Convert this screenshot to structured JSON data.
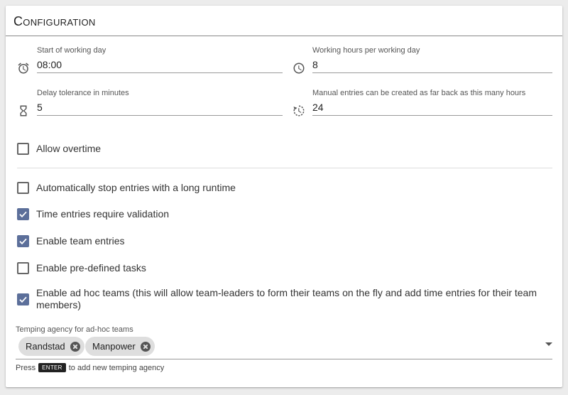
{
  "card": {
    "title": "Configuration"
  },
  "fields": {
    "start_of_working_day": {
      "label": "Start of working day",
      "value": "08:00",
      "icon": "alarm-clock-icon"
    },
    "working_hours": {
      "label": "Working hours per working day",
      "value": "8",
      "icon": "clock-icon"
    },
    "delay_tolerance": {
      "label": "Delay tolerance in minutes",
      "value": "5",
      "icon": "hourglass-icon"
    },
    "manual_entries": {
      "label": "Manual entries can be created as far back as this many hours",
      "value": "24",
      "icon": "history-clock-icon"
    }
  },
  "checkboxes": {
    "allow_overtime": {
      "label": "Allow overtime",
      "checked": false
    },
    "auto_stop": {
      "label": "Automatically stop entries with a long runtime",
      "checked": false
    },
    "require_validation": {
      "label": "Time entries require validation",
      "checked": true
    },
    "team_entries": {
      "label": "Enable team entries",
      "checked": true
    },
    "predefined_tasks": {
      "label": "Enable pre-defined tasks",
      "checked": false
    },
    "adhoc_teams": {
      "label": "Enable ad hoc teams (this will allow team-leaders to form their teams on the fly and add time entries for their team members)",
      "checked": true
    }
  },
  "temping_agency": {
    "label": "Temping agency for ad-hoc teams",
    "chips": [
      "Randstad",
      "Manpower"
    ],
    "hint_before": "Press",
    "hint_key": "ENTER",
    "hint_after": "to add new temping agency"
  },
  "colors": {
    "accent": "#5c6f9a",
    "chip_bg": "#dedede",
    "page_bg": "#ececec"
  }
}
